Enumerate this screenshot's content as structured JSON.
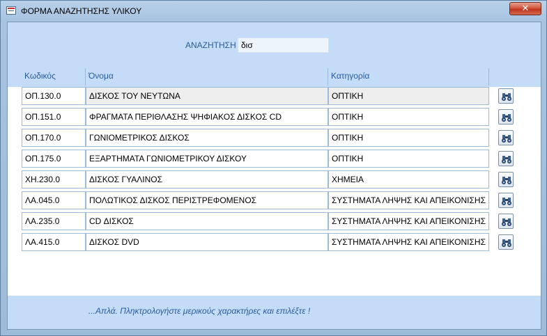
{
  "window": {
    "title": "ΦΟΡΜΑ ΑΝΑΖΗΤΗΣΗΣ ΥΛΙΚΟΥ",
    "close_label": "✕"
  },
  "search": {
    "label": "ΑΝΑΖΗΤΗΣΗ",
    "value": "δισ"
  },
  "columns": {
    "code": "Κωδικός",
    "name": "Όνομα",
    "category": "Κατηγορία"
  },
  "rows": [
    {
      "code": "ΟΠ.130.0",
      "name": "ΔΙΣΚΟΣ ΤΟΥ ΝΕΥΤΩΝΑ",
      "category": "ΟΠΤΙΚΗ"
    },
    {
      "code": "ΟΠ.151.0",
      "name": "ΦΡΑΓΜΑΤΑ ΠΕΡΙΘΛΑΣΗΣ ΨΗΦΙΑΚΟΣ ΔΙΣΚΟΣ CD",
      "category": "ΟΠΤΙΚΗ"
    },
    {
      "code": "ΟΠ.170.0",
      "name": "ΓΩΝΙΟΜΕΤΡΙΚΟΣ ΔΙΣΚΟΣ",
      "category": "ΟΠΤΙΚΗ"
    },
    {
      "code": "ΟΠ.175.0",
      "name": "ΕΞΑΡΤΗΜΑΤΑ ΓΩΝΙΟΜΕΤΡΙΚΟΥ ΔΙΣΚΟΥ",
      "category": "ΟΠΤΙΚΗ"
    },
    {
      "code": "ΧΗ.230.0",
      "name": "ΔΙΣΚΟΣ ΓΥΑΛΙΝΟΣ",
      "category": "ΧΗΜΕΙΑ"
    },
    {
      "code": "ΛΑ.045.0",
      "name": "ΠΟΛΩΤΙΚΟΣ ΔΙΣΚΟΣ ΠΕΡΙΣΤΡΕΦΟΜΕΝΟΣ",
      "category": "ΣΥΣΤΗΜΑΤΑ ΛΗΨΗΣ ΚΑΙ ΑΠΕΙΚΟΝΙΣΗΣ"
    },
    {
      "code": "ΛΑ.235.0",
      "name": "CD ΔΙΣΚΟΣ",
      "category": "ΣΥΣΤΗΜΑΤΑ ΛΗΨΗΣ ΚΑΙ ΑΠΕΙΚΟΝΙΣΗΣ"
    },
    {
      "code": "ΛΑ.415.0",
      "name": "ΔΙΣΚΟΣ DVD",
      "category": "ΣΥΣΤΗΜΑΤΑ ΛΗΨΗΣ ΚΑΙ ΑΠΕΙΚΟΝΙΣΗΣ"
    }
  ],
  "row_button_icon": "binoculars-icon",
  "footer": {
    "hint": "...Απλά. Πληκτρολογήστε μερικούς χαρακτήρες και επιλέξτε !"
  },
  "colors": {
    "label_blue": "#2b5b9a",
    "band": "#c5dcf8",
    "close_red": "#c2341c"
  }
}
